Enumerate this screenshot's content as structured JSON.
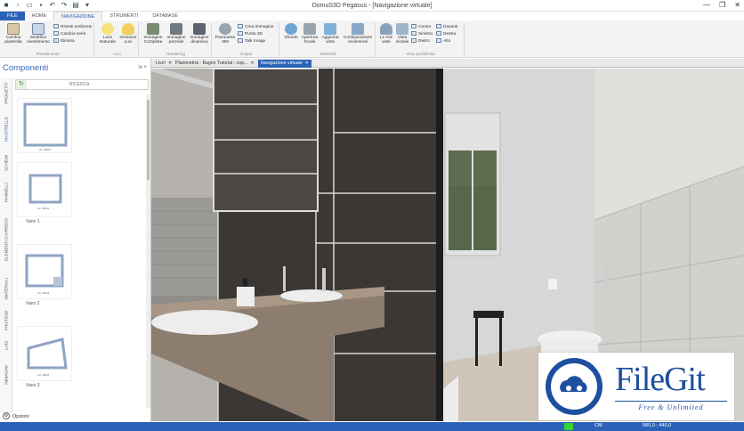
{
  "window": {
    "title": "DomuS3D Pegasus - [Navigazione virtuale]",
    "controls": [
      "—",
      "❐",
      "✕"
    ]
  },
  "ribbon_tabs": [
    "FILE",
    "HOME",
    "NAVIGAZIONE",
    "STRUMENTI",
    "DATABASE"
  ],
  "ribbon": {
    "groups": [
      {
        "name": "Rivestimento",
        "buttons": [
          "Cambia piastrella",
          "Modifica rivestimento"
        ],
        "small": [
          "Rivesti ambiente",
          "Cambia serie",
          "Elimina"
        ]
      },
      {
        "name": "Luci",
        "buttons": [
          "Luce Naturale",
          "Gestione Luci"
        ]
      },
      {
        "name": "Rendering",
        "buttons": [
          "Immagine Completa",
          "Immagine parziale",
          "Immagine dinamica"
        ]
      },
      {
        "name": "Output",
        "buttons": [
          "Panorama 360"
        ],
        "small": [
          "Crea immagine",
          "Punta 3D",
          "Talk Image"
        ]
      },
      {
        "name": "SlideS3D",
        "buttons": [
          "Sfondo",
          "Apertura focale",
          "Aggiorna vista",
          "Configurazione movimenti"
        ]
      },
      {
        "name": "Vista predefinita",
        "buttons": [
          "Le mie viste",
          "Vista iniziale"
        ],
        "small": [
          "Centro",
          "Sinistra",
          "Dietro",
          "Davanti",
          "Destra",
          "Alto"
        ]
      }
    ]
  },
  "left_panel": {
    "title": "Componenti",
    "pin": "⇲ ×",
    "search_label": "RICERCA",
    "vertical_tabs": [
      "PROGETTI",
      "PIASTRELLE",
      "SCHEMI",
      "PANNELLI",
      "ELEMENTI D'ARREDO",
      "MATERIALI",
      "PHOTO3D",
      "LUCI",
      "IMMAGINI"
    ],
    "items": [
      {
        "name": "",
        "dim": "cm. 300,0"
      },
      {
        "name": "Vano 1",
        "dim": "cm. 300,0"
      },
      {
        "name": "Vano 2",
        "dim": "cm. 300,0"
      },
      {
        "name": "Vano 3",
        "dim": "cm. 300,0"
      }
    ],
    "options_label": "Opzioni"
  },
  "doc_tabs": [
    {
      "label": "Live!",
      "close": "✕"
    },
    {
      "label": "Planimetria - Bagno Tutorial - cop...",
      "close": "✕"
    },
    {
      "label": "Navigazione virtuale",
      "close": "✕"
    }
  ],
  "status": {
    "unit": "CM",
    "coords": "580,0 ; 440,0"
  },
  "watermark": {
    "brand": "FileGit",
    "tagline": "Free & Unlimited"
  },
  "colors": {
    "accent": "#2b62b8",
    "brand": "#1d4f9e"
  }
}
